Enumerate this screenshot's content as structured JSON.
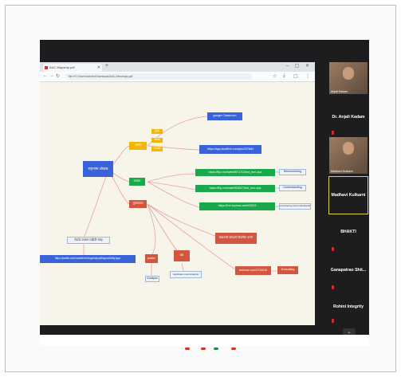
{
  "browser": {
    "tab_title": "AAC-Mapsmp.pdf",
    "new_tab": "+",
    "window_controls": "– ▢ ✕",
    "url": "file:///C:/Users/admin/Downloads/AAC-Mindmap.pdf"
  },
  "mindmap": {
    "central": "राष्ट्रभाषा ओळख",
    "branch_yellow": "साधने",
    "sub_yellow": [
      "App",
      "Web",
      "Tools"
    ],
    "branch_green": "उपक्रम",
    "branch_red": "मूल्यमापन",
    "link_classroom": "google Classroom",
    "link_studify": "https://app.studifive.com/join/257684",
    "link_flip1": "https://flip.vm/invite/8671701bed_mm-npa",
    "link_flip2": "https://flip.vm/invite/9538174ed_mm-npa",
    "link_topmac": "https://live.topmac.com/02519",
    "tag_remember": "Remembering",
    "tag_understand": "Understanding",
    "tag_remember_understand": "Remembering and understanding",
    "node_padlet_label": "पॅडलेट उपक्रम माहिती संग्रह",
    "link_padlet": "https://padlet.com/mastki/mh3ngwhdpcjolhkgulw5e5q4guz",
    "node_red_right": "लेखनाची कौशल्ये विकसित करणे",
    "node_test": "padlet",
    "node_quiz": "प्रश्न",
    "tag_analysis": "Analysis",
    "tag_apply": "Application and Analysis",
    "link_testmoz": "testmoz.com/3734410",
    "tag_evaluate": "Evaluating"
  },
  "participants": [
    {
      "name": "Dr. Anjali Kadam",
      "video_label": "Anjali Kadam",
      "has_video": true
    },
    {
      "name": "Madhavi Kulkarni",
      "video_label": "Madhavi Kulkarni",
      "has_video": true
    },
    {
      "name": "BHAKTI",
      "has_video": false
    },
    {
      "name": "Ganapatrao Shit...",
      "has_video": false
    },
    {
      "name": "Rohini Integrity",
      "has_video": false
    }
  ],
  "colors": {
    "blue": "#3b63d9",
    "yellow": "#f2b705",
    "green": "#19a84a",
    "red": "#d2553e",
    "line": "#e8a4a0"
  }
}
